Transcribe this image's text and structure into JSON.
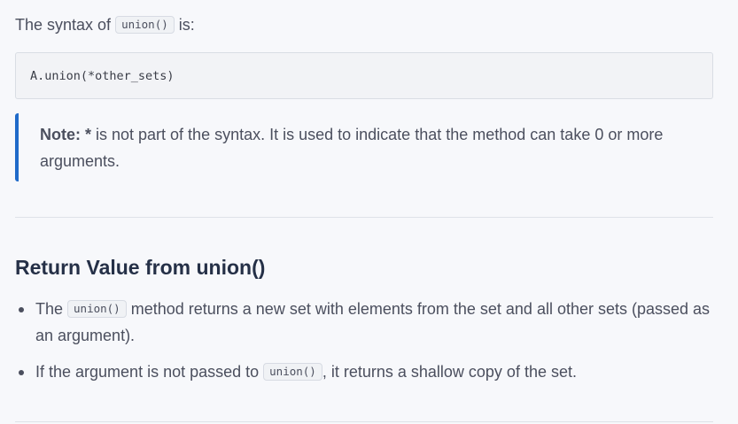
{
  "syntax": {
    "before": "The syntax of ",
    "code": "union()",
    "after": " is:"
  },
  "code_block": {
    "text": "A.union(*other_sets)"
  },
  "note": {
    "label": "Note: *",
    "text": " is not part of the syntax. It is used to indicate that the method can take 0 or more arguments."
  },
  "return_section": {
    "heading": "Return Value from union()",
    "bullets": [
      {
        "before": "The ",
        "code": "union()",
        "after": " method returns a new set with elements from the set and all other sets (passed as an argument)."
      },
      {
        "before": "If the argument is not passed to ",
        "code": "union()",
        "after": ", it returns a shallow copy of the set."
      }
    ]
  },
  "colors": {
    "note_border": "#1f6ac9",
    "heading": "#253047",
    "body_text": "#4b4f5e",
    "page_background": "#f7f8fb"
  }
}
